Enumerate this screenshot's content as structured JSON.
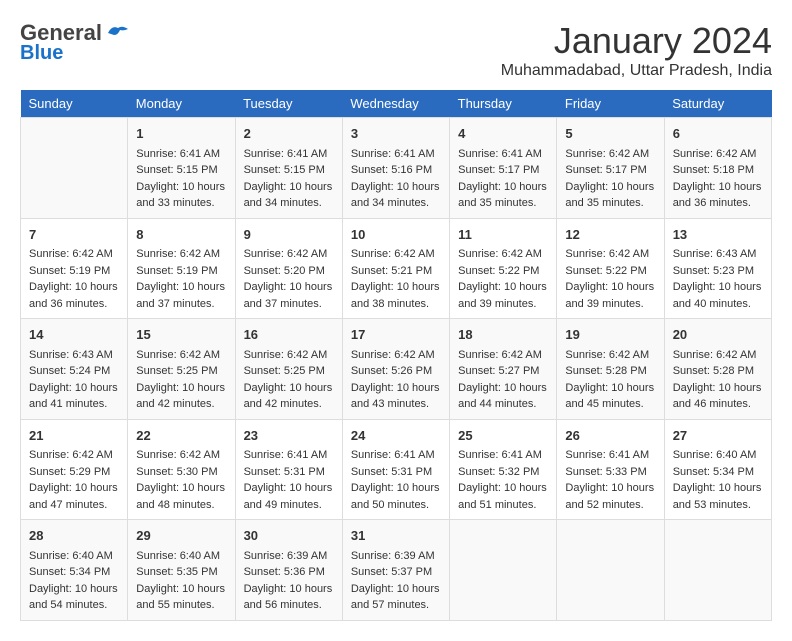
{
  "header": {
    "logo_general": "General",
    "logo_blue": "Blue",
    "month_year": "January 2024",
    "location": "Muhammadabad, Uttar Pradesh, India"
  },
  "days_of_week": [
    "Sunday",
    "Monday",
    "Tuesday",
    "Wednesday",
    "Thursday",
    "Friday",
    "Saturday"
  ],
  "weeks": [
    [
      {
        "day": "",
        "sunrise": "",
        "sunset": "",
        "daylight": ""
      },
      {
        "day": "1",
        "sunrise": "Sunrise: 6:41 AM",
        "sunset": "Sunset: 5:15 PM",
        "daylight": "Daylight: 10 hours and 33 minutes."
      },
      {
        "day": "2",
        "sunrise": "Sunrise: 6:41 AM",
        "sunset": "Sunset: 5:15 PM",
        "daylight": "Daylight: 10 hours and 34 minutes."
      },
      {
        "day": "3",
        "sunrise": "Sunrise: 6:41 AM",
        "sunset": "Sunset: 5:16 PM",
        "daylight": "Daylight: 10 hours and 34 minutes."
      },
      {
        "day": "4",
        "sunrise": "Sunrise: 6:41 AM",
        "sunset": "Sunset: 5:17 PM",
        "daylight": "Daylight: 10 hours and 35 minutes."
      },
      {
        "day": "5",
        "sunrise": "Sunrise: 6:42 AM",
        "sunset": "Sunset: 5:17 PM",
        "daylight": "Daylight: 10 hours and 35 minutes."
      },
      {
        "day": "6",
        "sunrise": "Sunrise: 6:42 AM",
        "sunset": "Sunset: 5:18 PM",
        "daylight": "Daylight: 10 hours and 36 minutes."
      }
    ],
    [
      {
        "day": "7",
        "sunrise": "Sunrise: 6:42 AM",
        "sunset": "Sunset: 5:19 PM",
        "daylight": "Daylight: 10 hours and 36 minutes."
      },
      {
        "day": "8",
        "sunrise": "Sunrise: 6:42 AM",
        "sunset": "Sunset: 5:19 PM",
        "daylight": "Daylight: 10 hours and 37 minutes."
      },
      {
        "day": "9",
        "sunrise": "Sunrise: 6:42 AM",
        "sunset": "Sunset: 5:20 PM",
        "daylight": "Daylight: 10 hours and 37 minutes."
      },
      {
        "day": "10",
        "sunrise": "Sunrise: 6:42 AM",
        "sunset": "Sunset: 5:21 PM",
        "daylight": "Daylight: 10 hours and 38 minutes."
      },
      {
        "day": "11",
        "sunrise": "Sunrise: 6:42 AM",
        "sunset": "Sunset: 5:22 PM",
        "daylight": "Daylight: 10 hours and 39 minutes."
      },
      {
        "day": "12",
        "sunrise": "Sunrise: 6:42 AM",
        "sunset": "Sunset: 5:22 PM",
        "daylight": "Daylight: 10 hours and 39 minutes."
      },
      {
        "day": "13",
        "sunrise": "Sunrise: 6:43 AM",
        "sunset": "Sunset: 5:23 PM",
        "daylight": "Daylight: 10 hours and 40 minutes."
      }
    ],
    [
      {
        "day": "14",
        "sunrise": "Sunrise: 6:43 AM",
        "sunset": "Sunset: 5:24 PM",
        "daylight": "Daylight: 10 hours and 41 minutes."
      },
      {
        "day": "15",
        "sunrise": "Sunrise: 6:42 AM",
        "sunset": "Sunset: 5:25 PM",
        "daylight": "Daylight: 10 hours and 42 minutes."
      },
      {
        "day": "16",
        "sunrise": "Sunrise: 6:42 AM",
        "sunset": "Sunset: 5:25 PM",
        "daylight": "Daylight: 10 hours and 42 minutes."
      },
      {
        "day": "17",
        "sunrise": "Sunrise: 6:42 AM",
        "sunset": "Sunset: 5:26 PM",
        "daylight": "Daylight: 10 hours and 43 minutes."
      },
      {
        "day": "18",
        "sunrise": "Sunrise: 6:42 AM",
        "sunset": "Sunset: 5:27 PM",
        "daylight": "Daylight: 10 hours and 44 minutes."
      },
      {
        "day": "19",
        "sunrise": "Sunrise: 6:42 AM",
        "sunset": "Sunset: 5:28 PM",
        "daylight": "Daylight: 10 hours and 45 minutes."
      },
      {
        "day": "20",
        "sunrise": "Sunrise: 6:42 AM",
        "sunset": "Sunset: 5:28 PM",
        "daylight": "Daylight: 10 hours and 46 minutes."
      }
    ],
    [
      {
        "day": "21",
        "sunrise": "Sunrise: 6:42 AM",
        "sunset": "Sunset: 5:29 PM",
        "daylight": "Daylight: 10 hours and 47 minutes."
      },
      {
        "day": "22",
        "sunrise": "Sunrise: 6:42 AM",
        "sunset": "Sunset: 5:30 PM",
        "daylight": "Daylight: 10 hours and 48 minutes."
      },
      {
        "day": "23",
        "sunrise": "Sunrise: 6:41 AM",
        "sunset": "Sunset: 5:31 PM",
        "daylight": "Daylight: 10 hours and 49 minutes."
      },
      {
        "day": "24",
        "sunrise": "Sunrise: 6:41 AM",
        "sunset": "Sunset: 5:31 PM",
        "daylight": "Daylight: 10 hours and 50 minutes."
      },
      {
        "day": "25",
        "sunrise": "Sunrise: 6:41 AM",
        "sunset": "Sunset: 5:32 PM",
        "daylight": "Daylight: 10 hours and 51 minutes."
      },
      {
        "day": "26",
        "sunrise": "Sunrise: 6:41 AM",
        "sunset": "Sunset: 5:33 PM",
        "daylight": "Daylight: 10 hours and 52 minutes."
      },
      {
        "day": "27",
        "sunrise": "Sunrise: 6:40 AM",
        "sunset": "Sunset: 5:34 PM",
        "daylight": "Daylight: 10 hours and 53 minutes."
      }
    ],
    [
      {
        "day": "28",
        "sunrise": "Sunrise: 6:40 AM",
        "sunset": "Sunset: 5:34 PM",
        "daylight": "Daylight: 10 hours and 54 minutes."
      },
      {
        "day": "29",
        "sunrise": "Sunrise: 6:40 AM",
        "sunset": "Sunset: 5:35 PM",
        "daylight": "Daylight: 10 hours and 55 minutes."
      },
      {
        "day": "30",
        "sunrise": "Sunrise: 6:39 AM",
        "sunset": "Sunset: 5:36 PM",
        "daylight": "Daylight: 10 hours and 56 minutes."
      },
      {
        "day": "31",
        "sunrise": "Sunrise: 6:39 AM",
        "sunset": "Sunset: 5:37 PM",
        "daylight": "Daylight: 10 hours and 57 minutes."
      },
      {
        "day": "",
        "sunrise": "",
        "sunset": "",
        "daylight": ""
      },
      {
        "day": "",
        "sunrise": "",
        "sunset": "",
        "daylight": ""
      },
      {
        "day": "",
        "sunrise": "",
        "sunset": "",
        "daylight": ""
      }
    ]
  ]
}
